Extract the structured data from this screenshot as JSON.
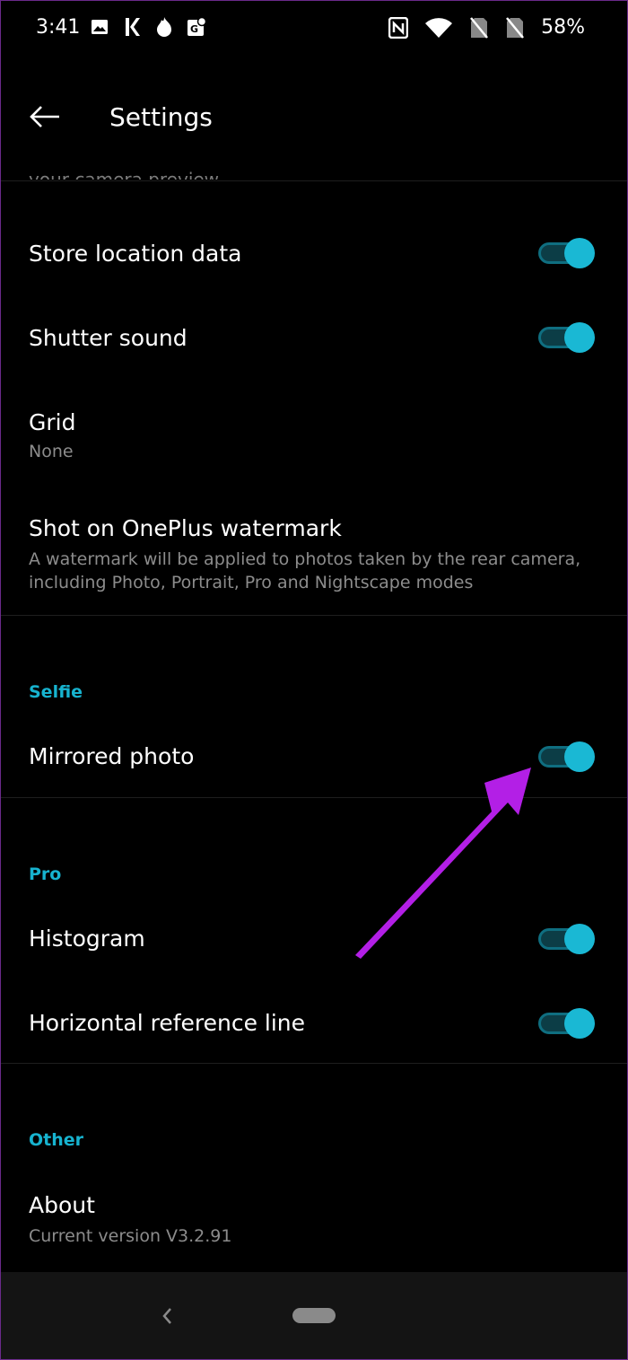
{
  "status_bar": {
    "time": "3:41",
    "left_icons": [
      "image-icon",
      "k-app-icon",
      "flame-icon",
      "maps-icon"
    ],
    "right_icons": [
      "nfc-icon",
      "wifi-icon",
      "no-sim-icon",
      "no-sim-icon"
    ],
    "battery": "58%"
  },
  "app_bar": {
    "title": "Settings",
    "back_icon": "arrow-left-icon"
  },
  "cut_text": "your camera preview",
  "rows": {
    "store_location": {
      "title": "Store location data",
      "toggle_on": true
    },
    "shutter_sound": {
      "title": "Shutter sound",
      "toggle_on": true
    },
    "grid": {
      "title": "Grid",
      "subtitle": "None"
    },
    "watermark": {
      "title": "Shot on OnePlus watermark",
      "subtitle": "A watermark will be applied to photos taken by the rear camera, including Photo, Portrait, Pro and Nightscape modes"
    },
    "mirrored_photo": {
      "title": "Mirrored photo",
      "toggle_on": true
    },
    "histogram": {
      "title": "Histogram",
      "toggle_on": true
    },
    "horizontal_line": {
      "title": "Horizontal reference line",
      "toggle_on": true
    },
    "about": {
      "title": "About",
      "subtitle": "Current version V3.2.91"
    }
  },
  "sections": {
    "selfie": "Selfie",
    "pro": "Pro",
    "other": "Other"
  },
  "colors": {
    "accent": "#1ab8d4",
    "background": "#000000",
    "annotation_arrow": "#b31fe6"
  },
  "nav_bar": {
    "back_icon": "chevron-left-icon",
    "home_icon": "home-pill-icon"
  }
}
